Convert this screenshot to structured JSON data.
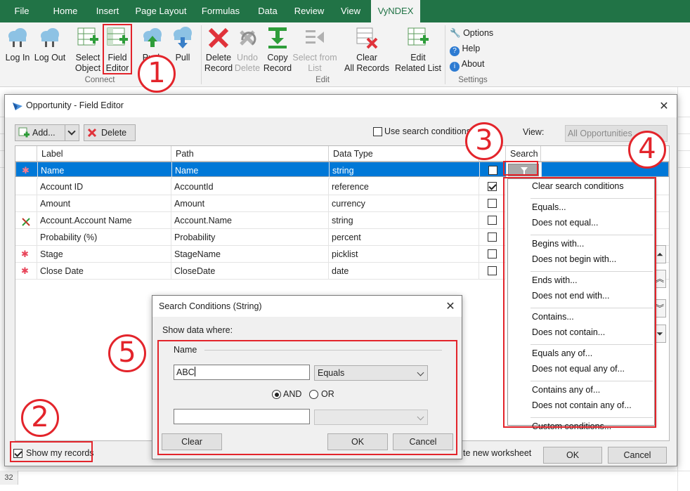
{
  "ribbon_tabs": [
    "File",
    "Home",
    "Insert",
    "Page Layout",
    "Formulas",
    "Data",
    "Review",
    "View",
    "VyNDEX"
  ],
  "ribbon": {
    "buttons": {
      "log_in": [
        "Log In"
      ],
      "log_out": [
        "Log Out"
      ],
      "select_object": [
        "Select",
        "Object"
      ],
      "field_editor": [
        "Field",
        "Editor"
      ],
      "push": [
        "Push"
      ],
      "pull": [
        "Pull"
      ],
      "delete_record": [
        "Delete",
        "Record"
      ],
      "undo_delete": [
        "Undo",
        "Delete"
      ],
      "copy_record": [
        "Copy",
        "Record"
      ],
      "select_from_list": [
        "Select from",
        "List"
      ],
      "clear_all_records": [
        "Clear",
        "All Records"
      ],
      "edit_related_list": [
        "Edit",
        "Related List"
      ]
    },
    "settings": [
      "Options",
      "Help",
      "About"
    ],
    "groups": [
      "Connect",
      "Edit",
      "Settings"
    ]
  },
  "dialog": {
    "title": "Opportunity - Field Editor",
    "toolbar": {
      "add": "Add...",
      "delete": "Delete",
      "use_search_conditions": "Use search conditions",
      "view_label": "View:",
      "view_value": "All Opportunities"
    },
    "columns": [
      "Label",
      "Path",
      "Data Type",
      "",
      "Search"
    ],
    "rows": [
      {
        "icon": "star",
        "label": "Name",
        "path": "Name",
        "type": "string",
        "checked": false,
        "selected": true
      },
      {
        "icon": "",
        "label": "Account ID",
        "path": "AccountId",
        "type": "reference",
        "checked": true,
        "selected": false
      },
      {
        "icon": "",
        "label": "Amount",
        "path": "Amount",
        "type": "currency",
        "checked": false,
        "selected": false
      },
      {
        "icon": "link",
        "label": "Account.Account Name",
        "path": "Account.Name",
        "type": "string",
        "checked": false,
        "selected": false
      },
      {
        "icon": "",
        "label": "Probability (%)",
        "path": "Probability",
        "type": "percent",
        "checked": false,
        "selected": false
      },
      {
        "icon": "asterisk",
        "label": "Stage",
        "path": "StageName",
        "type": "picklist",
        "checked": false,
        "selected": false
      },
      {
        "icon": "asterisk",
        "label": "Close Date",
        "path": "CloseDate",
        "type": "date",
        "checked": false,
        "selected": false
      }
    ],
    "show_my_records": "Show my records",
    "create_new_worksheet": "te new worksheet",
    "ok": "OK",
    "cancel": "Cancel"
  },
  "search_menu": [
    [
      "Clear search conditions"
    ],
    [
      "Equals...",
      "Does not equal..."
    ],
    [
      "Begins with...",
      "Does not begin with..."
    ],
    [
      "Ends with...",
      "Does not end with..."
    ],
    [
      "Contains...",
      "Does not contain..."
    ],
    [
      "Equals any of...",
      "Does not equal any of..."
    ],
    [
      "Contains any of...",
      "Does not contain any of..."
    ],
    [
      "Custom conditions..."
    ]
  ],
  "search_conditions": {
    "title": "Search Conditions (String)",
    "show_data_where": "Show data where:",
    "field_name": "Name",
    "value1": "ABC",
    "operator1": "Equals",
    "and_label": "AND",
    "or_label": "OR",
    "value2": "",
    "operator2": "",
    "clear": "Clear",
    "ok": "OK",
    "cancel": "Cancel"
  },
  "callouts": [
    "1",
    "2",
    "3",
    "4",
    "5"
  ],
  "sheet": {
    "row_number": "32"
  },
  "colors": {
    "excel_green": "#217346",
    "selection_blue": "#0078d7",
    "callout_red": "#e3242b"
  }
}
